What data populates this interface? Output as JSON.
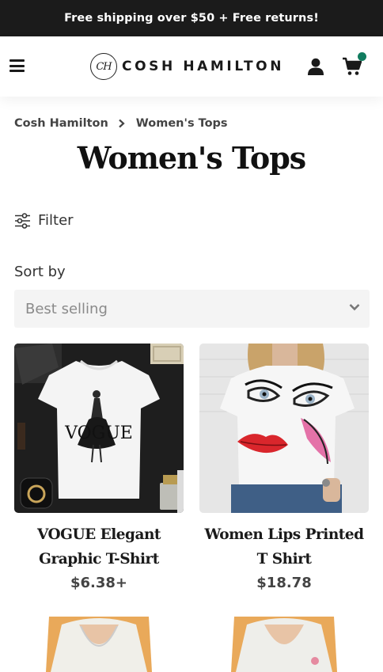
{
  "announcement": "Free shipping over $50 + Free returns!",
  "header": {
    "logo_mark": "CH",
    "logo_text": "COSH HAMILTON",
    "menu_icon": "hamburger-icon",
    "account_icon": "user-icon",
    "cart_icon": "cart-icon",
    "accent_color": "#117c5f"
  },
  "breadcrumb": {
    "home": "Cosh Hamilton",
    "current": "Women's Tops"
  },
  "page_title": "Women's Tops",
  "filter": {
    "label": "Filter",
    "icon": "sliders-icon"
  },
  "sort": {
    "label": "Sort by",
    "value": "Best selling"
  },
  "products": [
    {
      "name_line1": "VOGUE Elegant",
      "name_line2": "Graphic T-Shirt",
      "price": "$6.38+",
      "print_text": "VOGUE"
    },
    {
      "name_line1": "Women Lips Printed",
      "name_line2": "T Shirt",
      "price": "$18.78"
    }
  ]
}
